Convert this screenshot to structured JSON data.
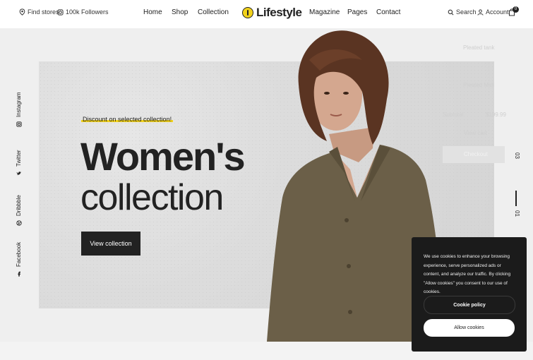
{
  "topbar": {
    "find_stores": "Find stores",
    "followers": "100k Followers",
    "nav": [
      "Home",
      "Shop",
      "Collection",
      "Magazine",
      "Pages",
      "Contact"
    ],
    "logo": "Lifestyle",
    "search": "Search",
    "account": "Account",
    "cart_count": "0"
  },
  "hero": {
    "eyebrow": "Discount on selected collection!",
    "title_line1": "Women's",
    "title_line2": "collection",
    "cta": "View collection",
    "accent_color": "#f2d21b"
  },
  "social": [
    "Instagram",
    "Twitter",
    "Dribbble",
    "Facebook"
  ],
  "pager": {
    "current": "01",
    "total": "03"
  },
  "mini_cart": {
    "item1": "Pleated tank",
    "item2": "Pleated Midi",
    "subtotal_label": "Subtotal",
    "subtotal_value": "$199.99",
    "view_cart": "View cart",
    "checkout": "Checkout"
  },
  "cookie": {
    "text": "We use cookies to enhance your browsing experience, serve personalized ads or content, and analyze our traffic. By clicking \"Allow cookies\" you consent to our use of cookies.",
    "policy": "Cookie policy",
    "allow": "Allow cookies"
  }
}
